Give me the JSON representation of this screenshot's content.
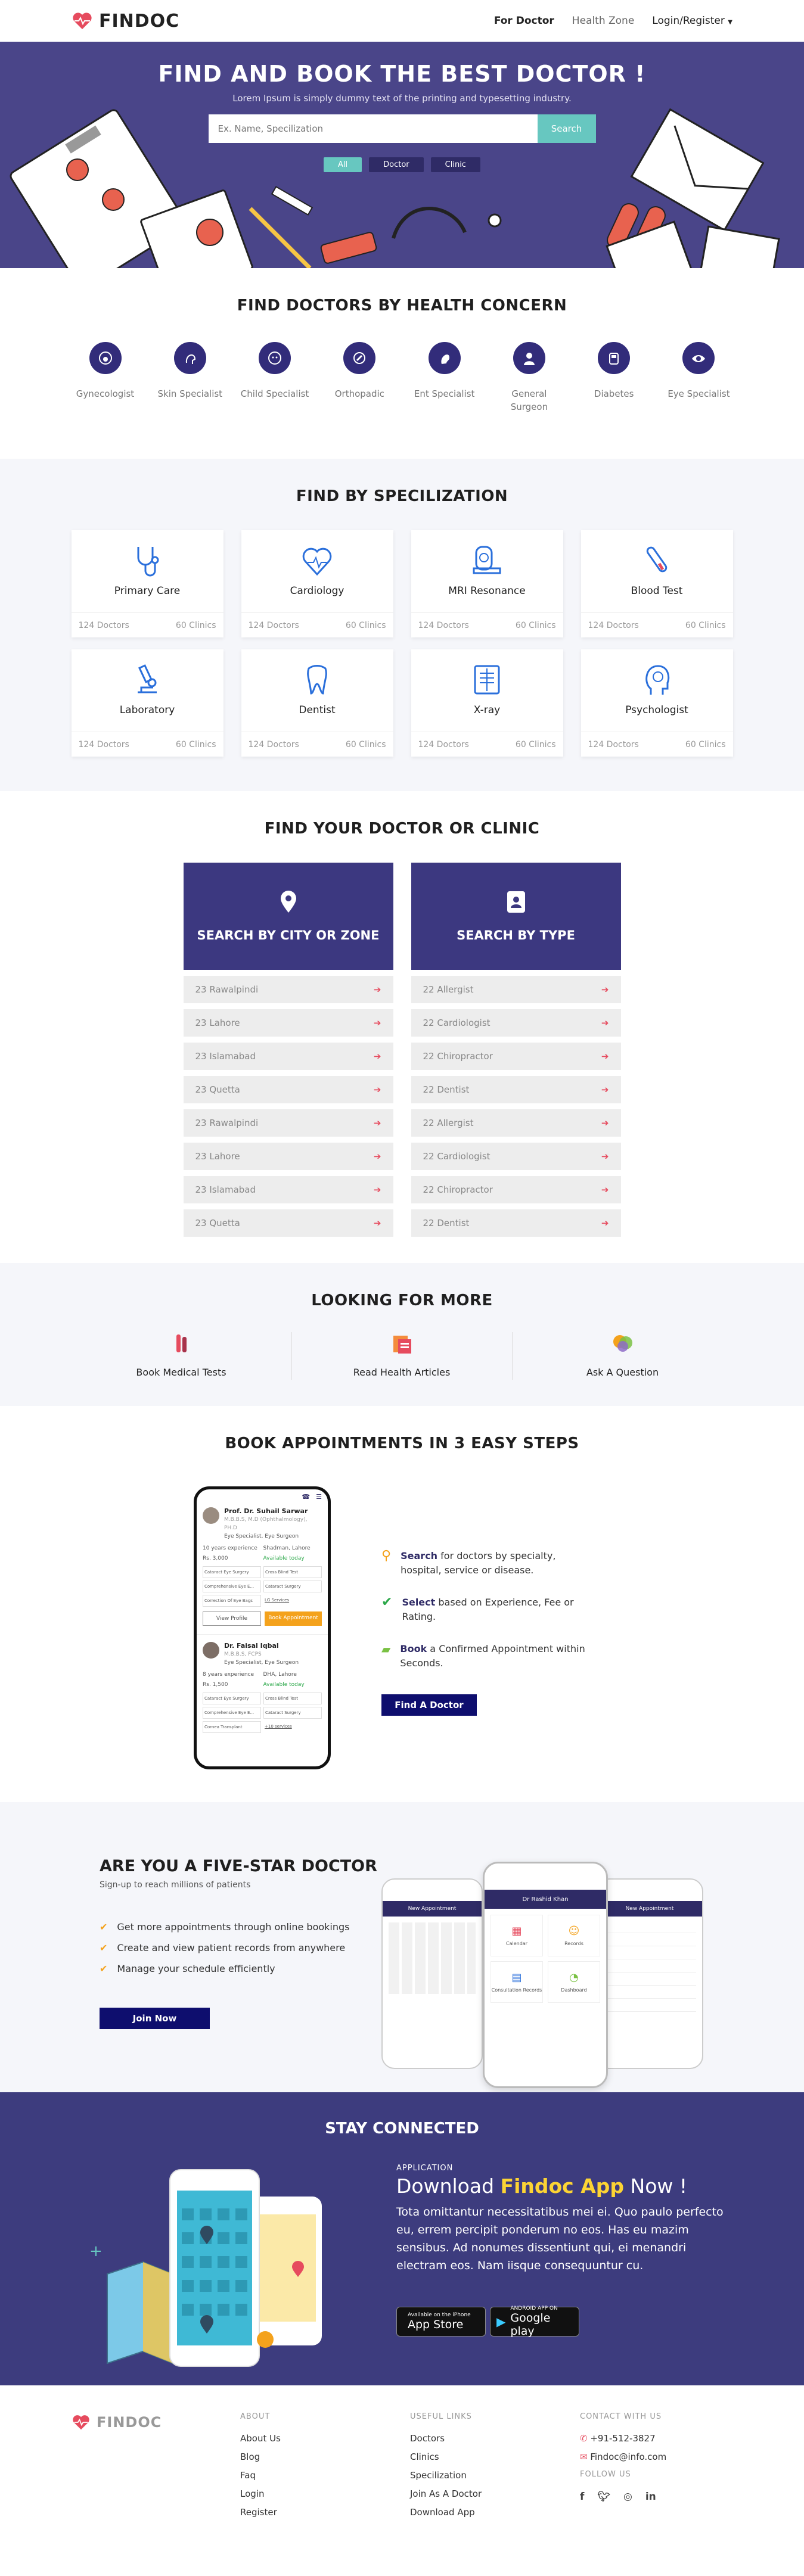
{
  "header": {
    "logo": "FINDOC",
    "nav": [
      "For Doctor",
      "Health Zone",
      "Login/Register"
    ]
  },
  "hero": {
    "title": "FIND AND BOOK THE BEST DOCTOR !",
    "subtitle": "Lorem Ipsum is simply dummy text of the printing and typesetting industry.",
    "search_placeholder": "Ex. Name, Specilization",
    "search_button": "Search",
    "filters": [
      "All",
      "Doctor",
      "Clinic"
    ]
  },
  "concern": {
    "title": "FIND DOCTORS BY HEALTH CONCERN",
    "items": [
      "Gynecologist",
      "Skin Specialist",
      "Child Specialist",
      "Orthopadic",
      "Ent Specialist",
      "General Surgeon",
      "Diabetes",
      "Eye Specialist"
    ]
  },
  "specialization": {
    "title": "FIND BY SPECILIZATION",
    "cards": [
      {
        "name": "Primary Care",
        "doctors": "124  Doctors",
        "clinics": "60 Clinics"
      },
      {
        "name": "Cardiology",
        "doctors": "124  Doctors",
        "clinics": "60 Clinics"
      },
      {
        "name": "MRI Resonance",
        "doctors": "124  Doctors",
        "clinics": "60 Clinics"
      },
      {
        "name": "Blood Test",
        "doctors": "124  Doctors",
        "clinics": "60 Clinics"
      },
      {
        "name": "Laboratory",
        "doctors": "124  Doctors",
        "clinics": "60 Clinics"
      },
      {
        "name": "Dentist",
        "doctors": "124  Doctors",
        "clinics": "60 Clinics"
      },
      {
        "name": "X-ray",
        "doctors": "124  Doctors",
        "clinics": "60 Clinics"
      },
      {
        "name": "Psychologist",
        "doctors": "124  Doctors",
        "clinics": "60 Clinics"
      }
    ]
  },
  "find_doctor": {
    "title": "FIND YOUR DOCTOR OR CLINIC",
    "city_head": "SEARCH BY CITY OR ZONE",
    "type_head": "SEARCH BY TYPE",
    "cities": [
      "23 Rawalpindi",
      "23 Lahore",
      "23 Islamabad",
      "23 Quetta",
      "23 Rawalpindi",
      "23 Lahore",
      "23 Islamabad",
      "23 Quetta"
    ],
    "types": [
      "22 Allergist",
      "22 Cardiologist",
      "22 Chiropractor",
      "22 Dentist",
      "22 Allergist",
      "22 Cardiologist",
      "22 Chiropractor",
      "22 Dentist"
    ]
  },
  "more": {
    "title": "LOOKING FOR MORE",
    "items": [
      "Book Medical Tests",
      "Read Health Articles",
      "Ask A Question"
    ]
  },
  "steps": {
    "title": "BOOK APPOINTMENTS IN 3 EASY STEPS",
    "list": [
      {
        "bold": "Search",
        "text": " for doctors by specialty, hospital, service or disease."
      },
      {
        "bold": "Select",
        "text": " based on Experience, Fee or Rating."
      },
      {
        "bold": "Book",
        "text": " a Confirmed Appointment within Seconds."
      }
    ],
    "button": "Find A Doctor",
    "phone": {
      "doc1": "Prof. Dr. Suhail Sarwar",
      "doc1_deg": "M.B.B.S, M.D (Ophthalmology), PH.D",
      "doc1_spec": "Eye Specialist, Eye Surgeon",
      "doc1_exp": "10 years experience",
      "doc1_loc": "Shadman, Lahore",
      "doc1_fee": "Rs. 3,000",
      "doc1_avail": "Available today",
      "tags1": [
        "Cataract Eye Surgery",
        "Cross Blind Test",
        "Comprehensive Eye E...",
        "Cataract Surgery",
        "Correction Of Eye Bags",
        "LG Services"
      ],
      "view": "View Profile",
      "book": "Book Appointment",
      "doc2": "Dr. Faisal Iqbal",
      "doc2_deg": "M.B.B.S, FCPS",
      "doc2_spec": "Eye Specialist, Eye Surgeon",
      "doc2_exp": "8 years experience",
      "doc2_loc": "DHA, Lahore",
      "doc2_fee": "Rs. 1,500",
      "doc2_avail": "Available today",
      "tags2": [
        "Cataract Eye Surgery",
        "Cross Blind Test",
        "Comprehensive Eye E...",
        "Cataract Surgery",
        "Cornea Transplant",
        "+10 services"
      ]
    }
  },
  "five": {
    "title": "ARE YOU A FIVE-STAR DOCTOR",
    "subtitle": "Sign-up to reach millions of patients",
    "list": [
      "Get more appointments through online bookings",
      "Create and view patient records from anywhere",
      "Manage your schedule efficiently"
    ],
    "button": "Join Now",
    "phone_center": "Dr Rashid Khan",
    "phone_left": "New Appointment",
    "phone_right": "New Appointment",
    "tiles": [
      "Calendar",
      "Records",
      "Consultation Records",
      "Dashboard"
    ]
  },
  "stay": {
    "title": "STAY CONNECTED",
    "app_label": "APPLICATION",
    "app_head_pre": "Download ",
    "app_head_y": "Findoc App",
    "app_head_post": " Now !",
    "app_text": "Tota omittantur necessitatibus mei ei. Quo paulo perfecto eu, errem percipit ponderum no eos. Has eu mazim sensibus. Ad nonumes dissentiunt qui, ei menandri electram eos. Nam iisque consequuntur cu.",
    "appstore_small": "Available on the iPhone",
    "appstore_big": "App Store",
    "google_small": "ANDROID APP ON",
    "google_big": "Google play"
  },
  "footer": {
    "logo": "FINDOC",
    "about_head": "ABOUT",
    "about": [
      "About Us",
      "Blog",
      "Faq",
      "Login",
      "Register"
    ],
    "links_head": "USEFUL LINKS",
    "links": [
      "Doctors",
      "Clinics",
      "Specilization",
      "Join As A Doctor",
      "Download App"
    ],
    "contact_head": "CONTACT WITH US",
    "phone": "+91-512-3827",
    "email": "Findoc@info.com",
    "follow_head": "FOLLOW US"
  }
}
